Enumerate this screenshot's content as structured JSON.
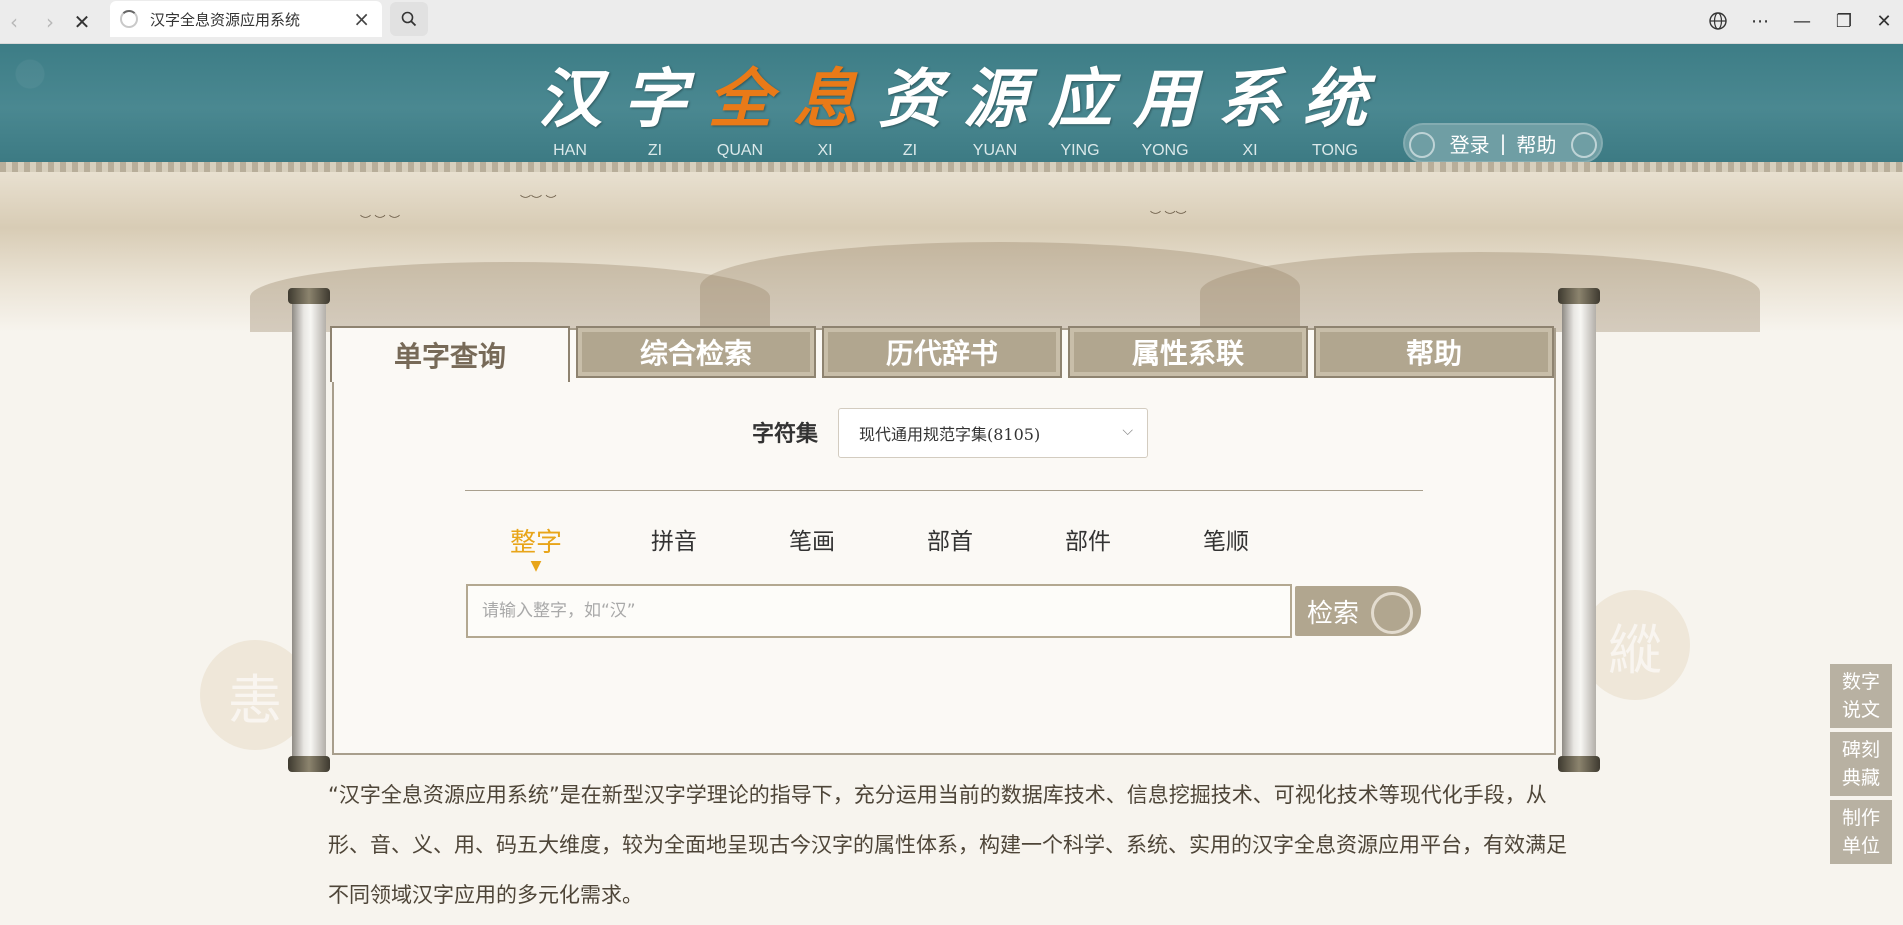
{
  "browser": {
    "tab_title": "汉字全息资源应用系统",
    "back_icon": "‹",
    "forward_icon": "›",
    "stop_icon": "✕",
    "close_icon": "×",
    "menu_icon": "⋯",
    "minimize_icon": "—",
    "restore_icon": "❐",
    "window_close_icon": "✕"
  },
  "header": {
    "title_chars": [
      {
        "glyph": "汉",
        "pinyin": "HAN"
      },
      {
        "glyph": "字",
        "pinyin": "ZI"
      },
      {
        "glyph": "全",
        "pinyin": "QUAN"
      },
      {
        "glyph": "息",
        "pinyin": "XI"
      },
      {
        "glyph": "资",
        "pinyin": "ZI"
      },
      {
        "glyph": "源",
        "pinyin": "YUAN"
      },
      {
        "glyph": "应",
        "pinyin": "YING"
      },
      {
        "glyph": "用",
        "pinyin": "YONG"
      },
      {
        "glyph": "系",
        "pinyin": "XI"
      },
      {
        "glyph": "统",
        "pinyin": "TONG"
      }
    ],
    "login": "登录",
    "separator": "|",
    "help": "帮助"
  },
  "panel": {
    "tabs": [
      "单字查询",
      "综合检索",
      "历代辞书",
      "属性系联",
      "帮助"
    ],
    "active_tab": 0,
    "charset_label": "字符集",
    "charset_value": "现代通用规范字集(8105)",
    "chevron": "⌵",
    "modes": [
      "整字",
      "拼音",
      "笔画",
      "部首",
      "部件",
      "笔顺"
    ],
    "active_mode": 0,
    "active_marker": "▼",
    "search_placeholder": "请输入整字，如“汉”",
    "search_button": "检索"
  },
  "description": "“汉字全息资源应用系统”是在新型汉字学理论的指导下，充分运用当前的数据库技术、信息挖掘技术、可视化技术等现代化手段，从形、音、义、用、码五大维度，较为全面地呈现古今汉字的属性体系，构建一个科学、系统、实用的汉字全息资源应用平台，有效满足不同领域汉字应用的多元化需求。",
  "side_buttons": [
    "数字说文",
    "碑刻典藏",
    "制作单位"
  ],
  "colors": {
    "header_teal": "#4a8891",
    "accent_orange": "#e97a18",
    "tab_tan": "#b1a68f",
    "mode_active": "#e8a519",
    "side_button": "#b8b1a2"
  }
}
